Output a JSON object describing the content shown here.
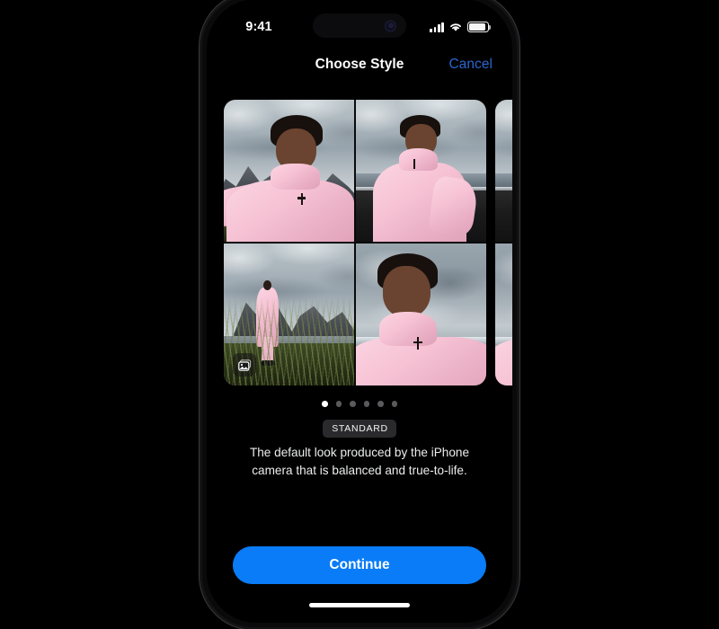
{
  "device": {
    "status_bar": {
      "time": "9:41",
      "cellular_icon": "cellular-bars-icon",
      "wifi_icon": "wifi-icon",
      "battery_icon": "battery-icon",
      "dynamic_island_camera_icon": "camera-indicator-icon"
    },
    "home_indicator": "home-indicator"
  },
  "nav": {
    "title": "Choose Style",
    "cancel_label": "Cancel",
    "cancel_color": "#2b66cc"
  },
  "carousel": {
    "library_badge_icon": "photo-library-icon",
    "cards": [
      {
        "name": "standard-style-card",
        "photos": [
          "portrait-selfie-mountains",
          "beach-black-sand-standing",
          "wide-grass-field-mountains",
          "portrait-closeup-moody-sky"
        ]
      },
      {
        "name": "next-style-card-preview",
        "photos": [
          "beach-black-sand-standing",
          "portrait-closeup-moody-sky"
        ]
      }
    ],
    "page_dots": {
      "total": 6,
      "active_index": 0
    }
  },
  "style_info": {
    "badge_label": "STANDARD",
    "description": "The default look produced by the iPhone camera that is balanced and true-to-life."
  },
  "footer": {
    "continue_label": "Continue",
    "continue_color": "#0a7cf7"
  }
}
